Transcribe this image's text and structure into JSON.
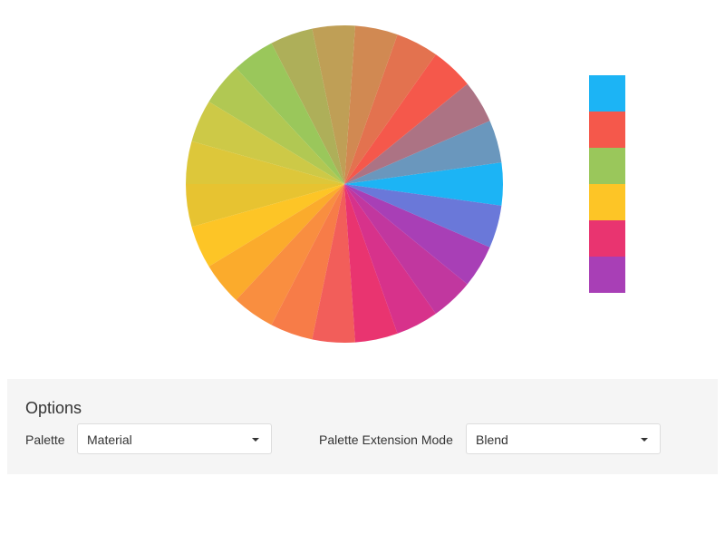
{
  "chart_data": {
    "type": "pie",
    "slice_count": 26,
    "slice_colors": [
      "#1cb4f5",
      "#6a97bd",
      "#ac7384",
      "#f5584b",
      "#e3724f",
      "#d18952",
      "#bf9f56",
      "#aeaf59",
      "#9ac75b",
      "#b1c853",
      "#cdc947",
      "#ddc73a",
      "#e7c331",
      "#fdc526",
      "#fbab2c",
      "#f98e40",
      "#f77c48",
      "#f25e5a",
      "#e93470",
      "#d7328b",
      "#c1379f",
      "#a83fb6",
      "#6a78d9"
    ],
    "legend_colors": [
      "#1cb4f5",
      "#f5584b",
      "#9ac75b",
      "#fdc526",
      "#e93470",
      "#a83fb6"
    ],
    "legend_placement": "right"
  },
  "options": {
    "title": "Options",
    "palette_label": "Palette",
    "palette_value": "Material",
    "extension_label": "Palette Extension Mode",
    "extension_value": "Blend"
  }
}
